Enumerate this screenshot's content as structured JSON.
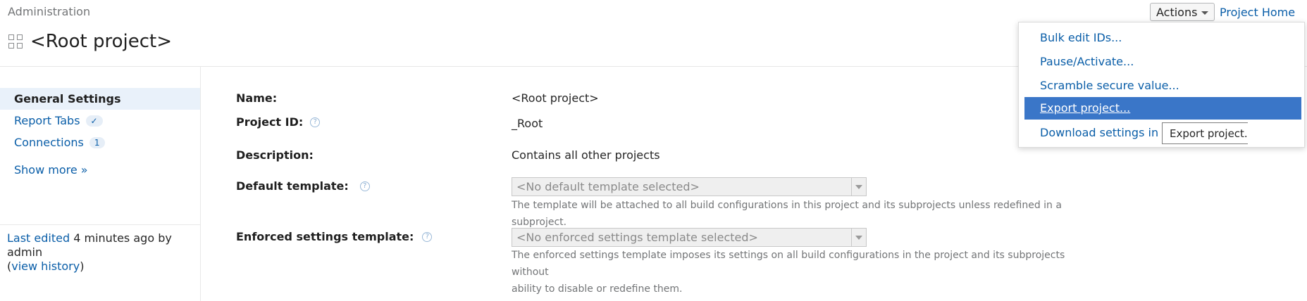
{
  "header": {
    "breadcrumb": "Administration",
    "page_title": "<Root project>",
    "actions_label": "Actions",
    "project_home_label": "Project Home"
  },
  "sidebar": {
    "items": [
      {
        "label": "General Settings"
      },
      {
        "label": "Report Tabs",
        "badge": "✓"
      },
      {
        "label": "Connections",
        "badge": "1"
      },
      {
        "label": "Show more »"
      }
    ],
    "last_edited_prefix": "Last edited",
    "last_edited_rest": "4 minutes ago by admin",
    "open_paren": "(",
    "view_history": "view history",
    "close_paren": ")"
  },
  "form": {
    "name_label": "Name:",
    "name_value": "<Root project>",
    "project_id_label": "Project ID:",
    "project_id_value": "_Root",
    "description_label": "Description:",
    "description_value": "Contains all other projects",
    "default_template_label": "Default template:",
    "default_template_value": "<No default template selected>",
    "default_template_hint": "The template will be attached to all build configurations in this project and its subprojects unless redefined in a subproject.",
    "enforced_template_label": "Enforced settings template:",
    "enforced_template_value": "<No enforced settings template selected>",
    "enforced_template_hint_line1": "The enforced settings template imposes its settings on all build configurations in the project and its subprojects without",
    "enforced_template_hint_line2": "ability to disable or redefine them."
  },
  "actions_menu": {
    "items": [
      "Bulk edit IDs...",
      "Pause/Activate...",
      "Scramble secure value...",
      "Export project...",
      "Download settings in Ko"
    ],
    "highlighted_index": 3,
    "tooltip": "Export project..."
  },
  "colors": {
    "link": "#0a5ea8",
    "menu_highlight": "#3a76c8",
    "sidebar_active": "#e9f1fa"
  },
  "icons": {
    "title": "project-grid-icon",
    "help": "help-circle-icon",
    "caret": "caret-down-icon"
  }
}
